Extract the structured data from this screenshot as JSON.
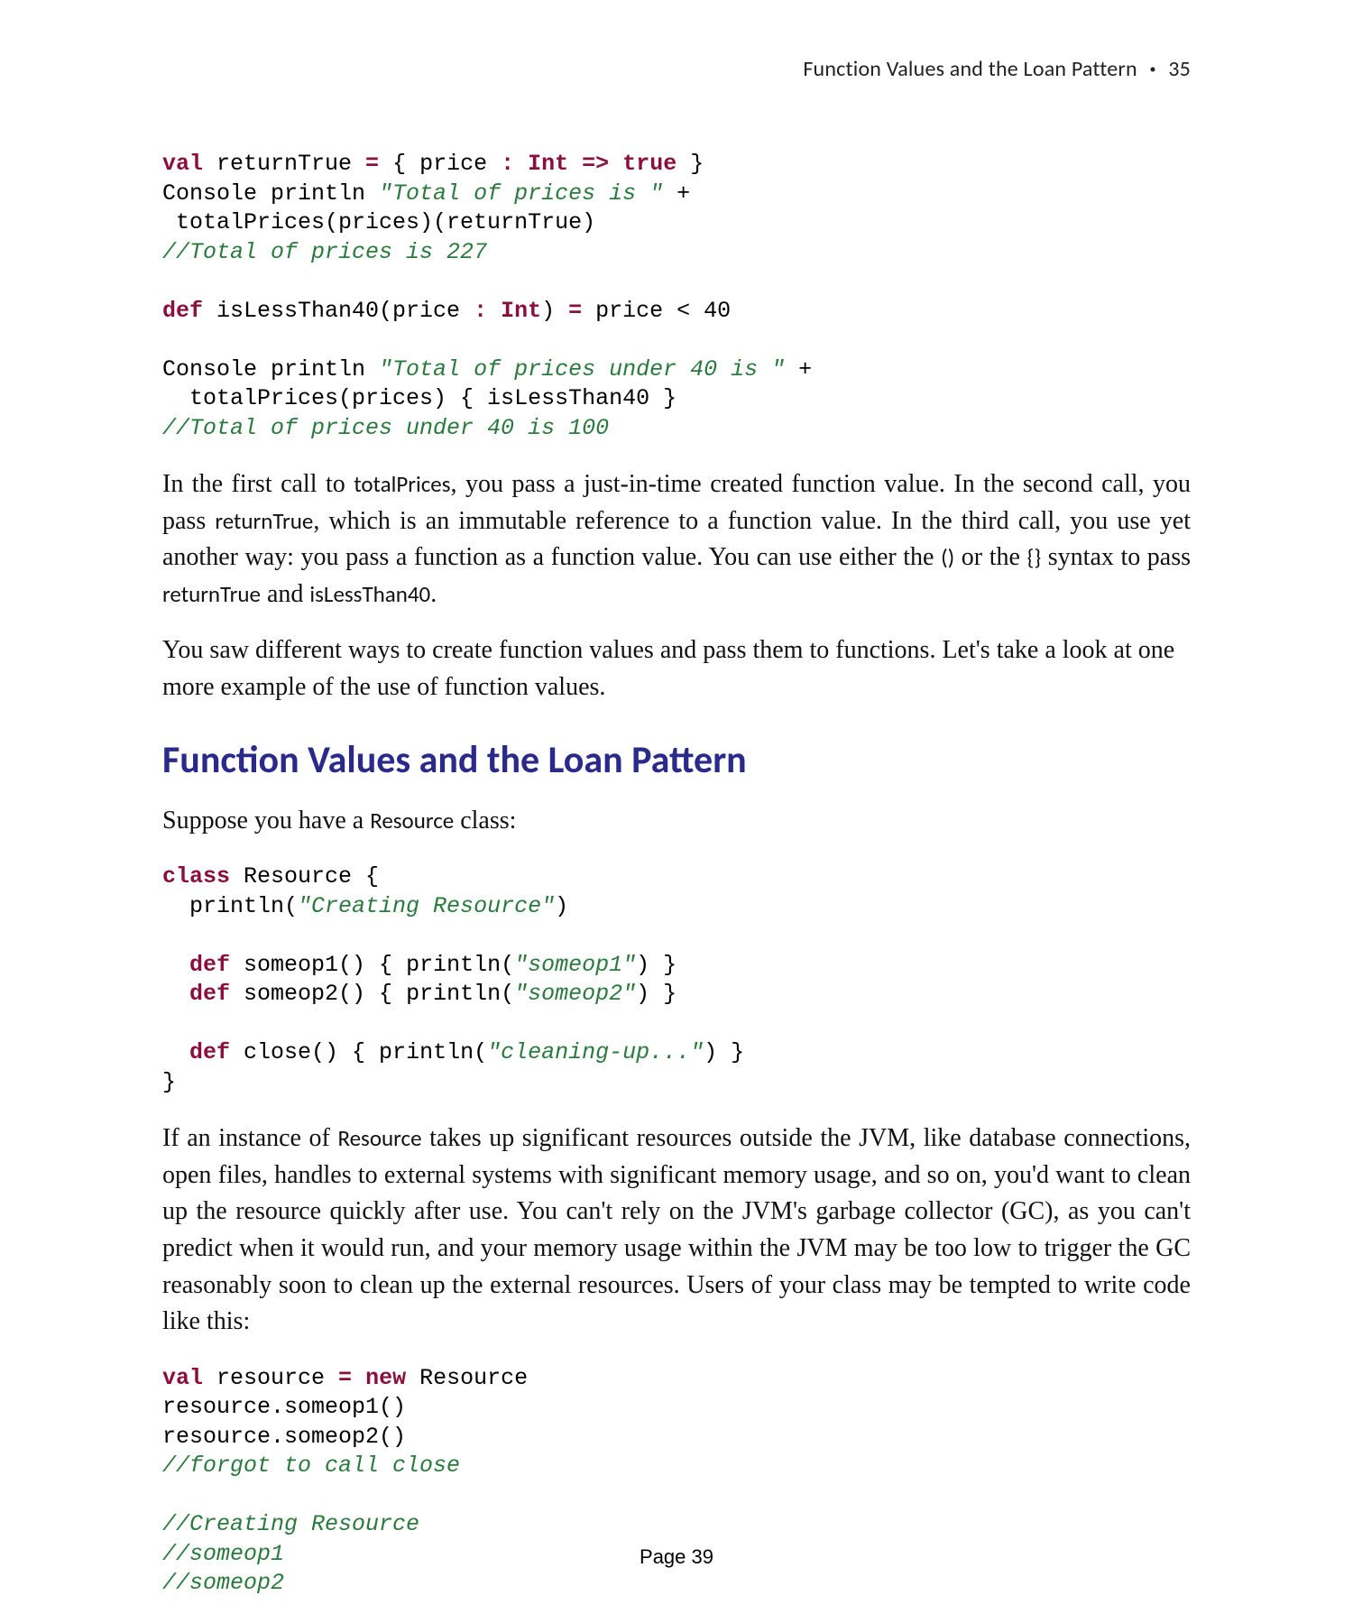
{
  "header": {
    "title": "Function Values and the Loan Pattern",
    "bullet": "•",
    "page_num": "35"
  },
  "code1": {
    "l1": {
      "kw1": "val",
      "mid": " returnTrue ",
      "kw2": "=",
      "mid2": " { price ",
      "kw3": ":",
      "mid3": " ",
      "kw4": "Int",
      "mid4": " ",
      "kw5": "=>",
      "mid5": " ",
      "kw6": "true",
      "tail": " }"
    },
    "l2a": "Console println ",
    "l2s": "\"Total of prices is \"",
    "l2b": " +",
    "l3": " totalPrices(prices)(returnTrue)",
    "l4": "//Total of prices is 227",
    "l5": {
      "kw1": "def",
      "a": " isLessThan40(price ",
      "kw2": ":",
      "b": " ",
      "kw3": "Int",
      "c": ") ",
      "kw4": "=",
      "d": " price < 40"
    },
    "l6a": "Console println ",
    "l6s": "\"Total of prices under 40 is \"",
    "l6b": " +",
    "l7": "  totalPrices(prices) { isLessThan40 }",
    "l8": "//Total of prices under 40 is 100"
  },
  "para1": {
    "t0": "In the first call to ",
    "c0": "totalPrices",
    "t1": ", you pass a just-in-time created function value. In the second call, you pass ",
    "c1": "returnTrue",
    "t2": ", which is an immutable reference to a function value. In the third call, you use yet another way: you pass a function as a function value. You can use either the ",
    "c2": "()",
    "t3": " or the ",
    "c3": "{}",
    "t4": " syntax to pass ",
    "c4": "returnTrue",
    "t5": " and ",
    "c5": "isLessThan40",
    "t6": "."
  },
  "para2": "You saw different ways to create function values and pass them to functions. Let's take a look at one more example of the use of function values.",
  "section_title": "Function Values and the Loan Pattern",
  "para3": {
    "t0": "Suppose you have a ",
    "c0": "Resource",
    "t1": " class:"
  },
  "code2": {
    "l1": {
      "kw1": "class",
      "a": " Resource {"
    },
    "l2a": "  println(",
    "l2s": "\"Creating Resource\"",
    "l2b": ")",
    "l3": {
      "kw1": "def",
      "a": " someop1() { println(",
      "s": "\"someop1\"",
      "b": ") }"
    },
    "l4": {
      "kw1": "def",
      "a": " someop2() { println(",
      "s": "\"someop2\"",
      "b": ") }"
    },
    "l5": {
      "kw1": "def",
      "a": " close() { println(",
      "s": "\"cleaning-up...\"",
      "b": ") }"
    },
    "l6": "}"
  },
  "para4": {
    "t0": "If an instance of ",
    "c0": "Resource",
    "t1": " takes up significant resources outside the JVM, like database connections, open files, handles to external systems with significant memory usage, and so on, you'd want to clean up the resource quickly after use. You can't rely on the JVM's garbage collector (GC), as you can't predict when it would run, and your memory usage within the JVM may be too low to trigger the GC reasonably soon to clean up the external resources. Users of your class may be tempted to write code like this:"
  },
  "code3": {
    "l1": {
      "kw1": "val",
      "a": " resource ",
      "kw2": "=",
      "b": " ",
      "kw3": "new",
      "c": " Resource"
    },
    "l2": "resource.someop1()",
    "l3": "resource.someop2()",
    "l4": "//forgot to call close",
    "l5": "//Creating Resource",
    "l6": "//someop1",
    "l7": "//someop2"
  },
  "footer": "Page 39"
}
